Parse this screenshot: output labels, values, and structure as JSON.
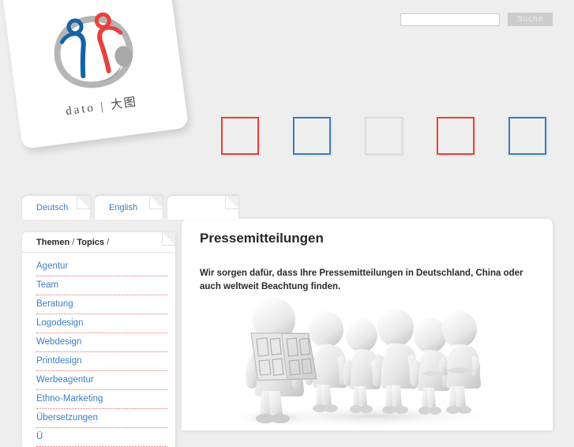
{
  "brand": {
    "logo_text": "dato",
    "logo_divider": "|",
    "logo_cjk": "大图",
    "logo_icon": "two-figures-in-ink-circle",
    "color_blue": "#1464a5",
    "color_red": "#e8413c",
    "color_grey": "#b3b3b3"
  },
  "search": {
    "value": "",
    "placeholder": "",
    "button_label": "Suche",
    "icon": "search-icon"
  },
  "boxes": [
    {
      "name": "box-1",
      "color": "#e8413c",
      "variant": "red"
    },
    {
      "name": "box-2",
      "color": "#3d7cc0",
      "variant": "blue"
    },
    {
      "name": "box-3",
      "color": "#dcdcdc",
      "variant": "grey"
    },
    {
      "name": "box-4",
      "color": "#e8413c",
      "variant": "red"
    },
    {
      "name": "box-5",
      "color": "#3d7cc0",
      "variant": "blue"
    }
  ],
  "tabs": [
    {
      "label": "Deutsch",
      "active": true
    },
    {
      "label": "English",
      "active": false
    },
    {
      "label": "",
      "active": false
    }
  ],
  "sidebar": {
    "header_main": "Themen",
    "header_sep_1": "/",
    "header_sub": "Topics",
    "header_sep_2": "/",
    "items": [
      {
        "label": "Agentur"
      },
      {
        "label": "Team"
      },
      {
        "label": "Beratung"
      },
      {
        "label": "Logodesign"
      },
      {
        "label": "Webdesign"
      },
      {
        "label": "Printdesign"
      },
      {
        "label": "Werbeagentur"
      },
      {
        "label": "Ethno-Marketing"
      },
      {
        "label": "Übersetzungen"
      },
      {
        "label": "Ü"
      }
    ]
  },
  "main": {
    "title": "Pressemitteilungen",
    "intro": "Wir sorgen dafür, dass Ihre Pressemitteilungen in Deutschland, China oder auch weltweit Beachtung finden.",
    "image_alt": "3d-figures-reading-newspaper-illustration"
  }
}
